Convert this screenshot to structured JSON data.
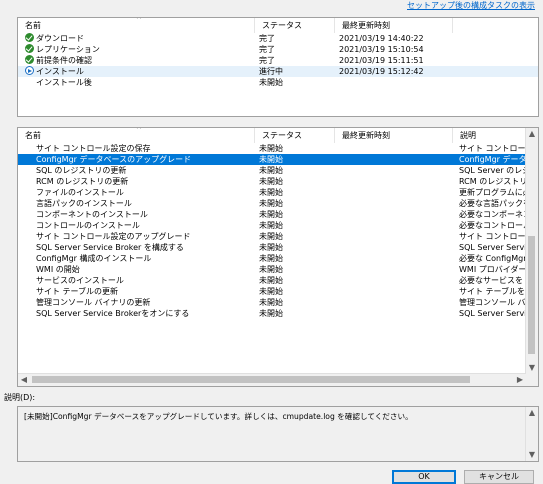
{
  "top_link": "セットアップ後の構成タスクの表示",
  "panel1": {
    "headers": [
      "名前",
      "ステータス",
      "最終更新時刻"
    ],
    "rows": [
      {
        "icon": "done",
        "name": "ダウンロード",
        "status": "完了",
        "time": "2021/03/19 14:40:22"
      },
      {
        "icon": "done",
        "name": "レプリケーション",
        "status": "完了",
        "time": "2021/03/19 15:10:54"
      },
      {
        "icon": "done",
        "name": "前提条件の確認",
        "status": "完了",
        "time": "2021/03/19 15:11:51"
      },
      {
        "icon": "run",
        "name": "インストール",
        "status": "進行中",
        "time": "2021/03/19 15:12:42"
      },
      {
        "icon": "",
        "name": "インストール後",
        "status": "未開始",
        "time": ""
      }
    ]
  },
  "panel2": {
    "headers": [
      "名前",
      "ステータス",
      "最終更新時刻",
      "説明"
    ],
    "rows": [
      {
        "name": "サイト コントロール設定の保存",
        "status": "未開始",
        "time": "",
        "desc": "サイト コントロール設定",
        "selected": false
      },
      {
        "name": "ConfigMgr データベースのアップグレード",
        "status": "未開始",
        "time": "",
        "desc": "ConfigMgr データベース",
        "selected": true
      },
      {
        "name": "SQL のレジストリの更新",
        "status": "未開始",
        "time": "",
        "desc": "SQL Server のレジストリ",
        "selected": false
      },
      {
        "name": "RCM のレジストリの更新",
        "status": "未開始",
        "time": "",
        "desc": "RCM のレジストリを更新",
        "selected": false
      },
      {
        "name": "ファイルのインストール",
        "status": "未開始",
        "time": "",
        "desc": "更新プログラムに必要な",
        "selected": false
      },
      {
        "name": "言語パックのインストール",
        "status": "未開始",
        "time": "",
        "desc": "必要な言語パックを",
        "selected": false
      },
      {
        "name": "コンポーネントのインストール",
        "status": "未開始",
        "time": "",
        "desc": "必要なコンポーネント",
        "selected": false
      },
      {
        "name": "コントロールのインストール",
        "status": "未開始",
        "time": "",
        "desc": "必要なコントロール",
        "selected": false
      },
      {
        "name": "サイト コントロール設定のアップグレード",
        "status": "未開始",
        "time": "",
        "desc": "サイト コントロール設定",
        "selected": false
      },
      {
        "name": "SQL Server Service Broker を構成する",
        "status": "未開始",
        "time": "",
        "desc": "SQL Server Service",
        "selected": false
      },
      {
        "name": "ConfigMgr 構成のインストール",
        "status": "未開始",
        "time": "",
        "desc": "必要な ConfigMgr 構成",
        "selected": false
      },
      {
        "name": "WMI の開始",
        "status": "未開始",
        "time": "",
        "desc": "WMI プロバイダーを",
        "selected": false
      },
      {
        "name": "サービスのインストール",
        "status": "未開始",
        "time": "",
        "desc": "必要なサービスを",
        "selected": false
      },
      {
        "name": "サイト テーブルの更新",
        "status": "未開始",
        "time": "",
        "desc": "サイト テーブルを更新",
        "selected": false
      },
      {
        "name": "管理コンソール バイナリの更新",
        "status": "未開始",
        "time": "",
        "desc": "管理コンソール バイナリ",
        "selected": false
      },
      {
        "name": "SQL Server Service Brokerをオンにする",
        "status": "未開始",
        "time": "",
        "desc": "SQL Server Service",
        "selected": false
      }
    ]
  },
  "description_label": "説明(D):",
  "description_text": "[未開始]ConfigMgr データベースをアップグレードしています。詳しくは、cmupdate.log を確認してください。",
  "buttons": {
    "ok": "OK",
    "cancel": "キャンセル"
  }
}
